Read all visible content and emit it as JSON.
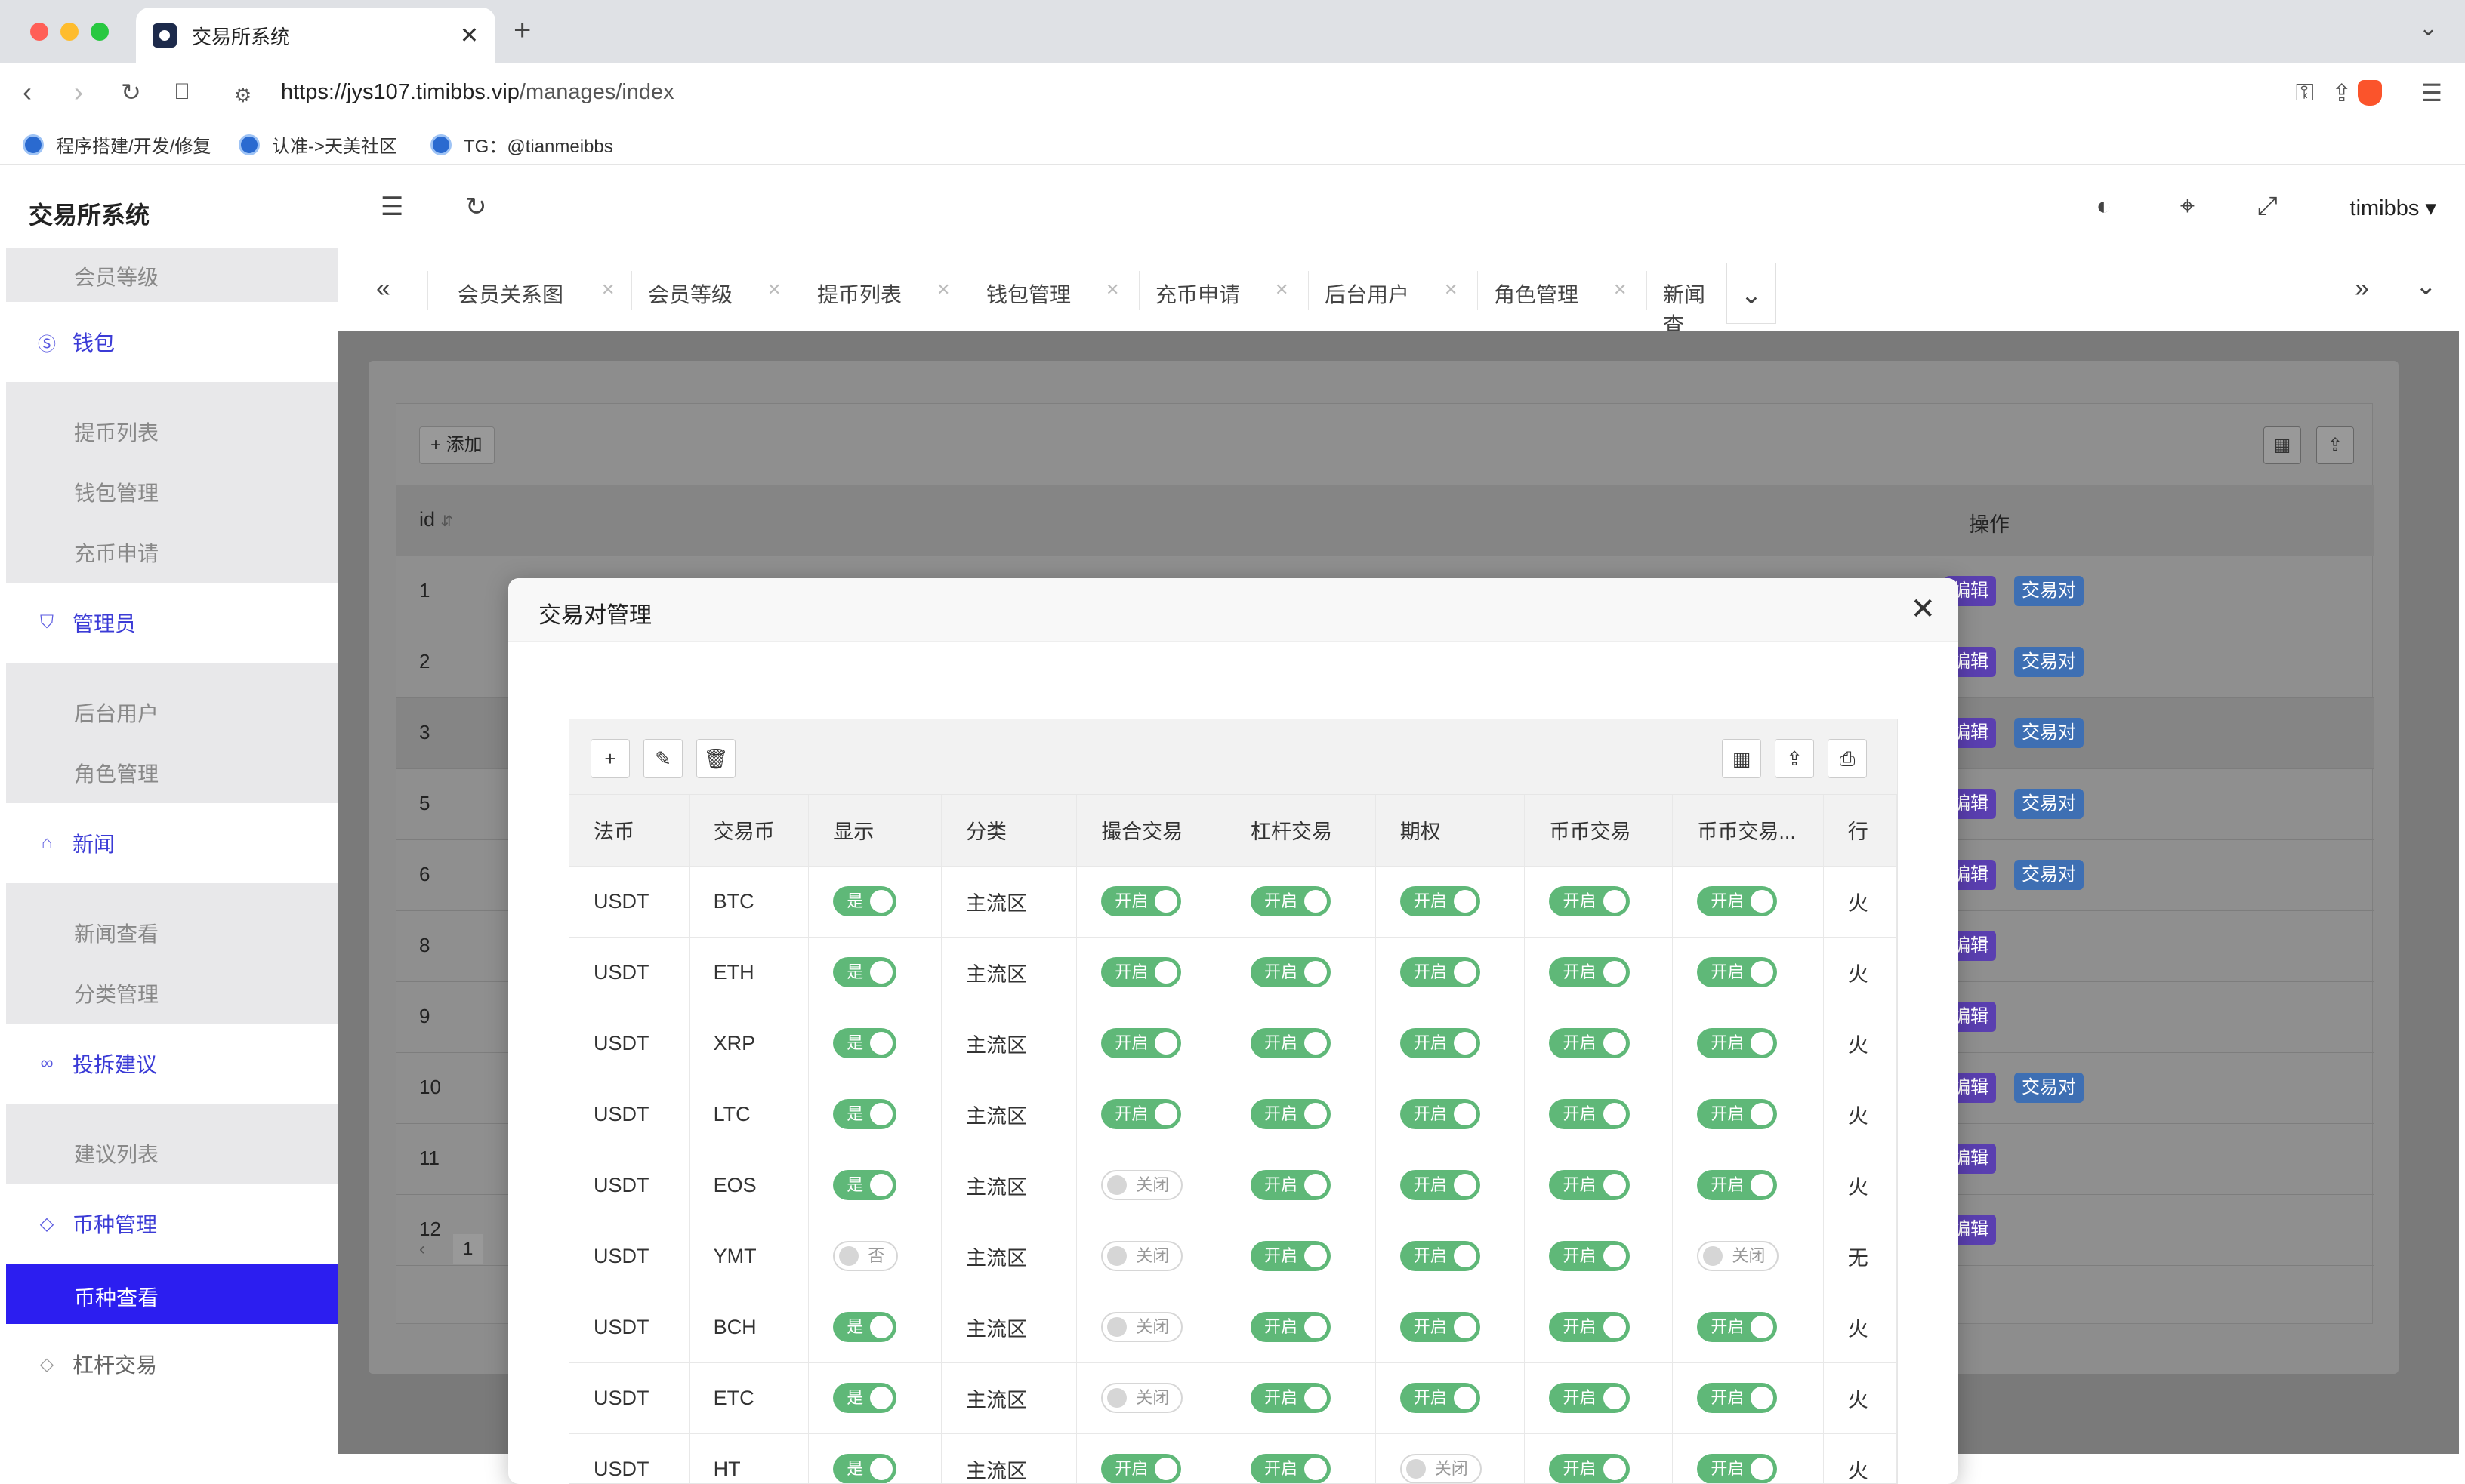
{
  "browser": {
    "tab_title": "交易所系统",
    "url_host": "https://jys107.timibbs.vip",
    "url_path": "/manages/index",
    "bookmarks": [
      "程序搭建/开发/修复",
      "认准->天美社区",
      "TG：@tianmeibbs"
    ]
  },
  "app": {
    "title": "交易所系统",
    "user": "timibbs"
  },
  "sidebar": {
    "member_level": "会员等级",
    "wallet": "钱包",
    "withdraw_list": "提币列表",
    "wallet_mgmt": "钱包管理",
    "recharge": "充币申请",
    "admin": "管理员",
    "backend_users": "后台用户",
    "roles": "角色管理",
    "news": "新闻",
    "news_view": "新闻查看",
    "category": "分类管理",
    "complaint": "投拆建议",
    "suggest_list": "建议列表",
    "coin_mgmt": "币种管理",
    "coin_view": "币种查看",
    "leverage": "杠杆交易"
  },
  "tabs": [
    "会员关系图",
    "会员等级",
    "提币列表",
    "钱包管理",
    "充币申请",
    "后台用户",
    "角色管理",
    "新闻查"
  ],
  "bg_table": {
    "add_label": "+ 添加",
    "id_header": "id",
    "ops_header": "操作",
    "edit_label": "编辑",
    "pair_label": "交易对",
    "page": "1",
    "rows": [
      {
        "id": "1",
        "pair": true
      },
      {
        "id": "2",
        "pair": true
      },
      {
        "id": "3",
        "pair": true
      },
      {
        "id": "5",
        "pair": true
      },
      {
        "id": "6",
        "pair": true
      },
      {
        "id": "8",
        "pair": false
      },
      {
        "id": "9",
        "pair": false
      },
      {
        "id": "10",
        "pair": true
      },
      {
        "id": "11",
        "pair": false
      },
      {
        "id": "12",
        "pair": false
      }
    ]
  },
  "modal": {
    "title": "交易对管理",
    "headers": [
      "法币",
      "交易币",
      "显示",
      "分类",
      "撮合交易",
      "杠杆交易",
      "期权",
      "币币交易",
      "币币交易...",
      "行"
    ],
    "on_label": "开启",
    "off_label": "关闭",
    "show_yes": "是",
    "show_no": "否",
    "rows": [
      {
        "fiat": "USDT",
        "coin": "BTC",
        "show": true,
        "cat": "主流区",
        "match": true,
        "lev": true,
        "opt": true,
        "c2c": true,
        "c2c2": true,
        "last": "火"
      },
      {
        "fiat": "USDT",
        "coin": "ETH",
        "show": true,
        "cat": "主流区",
        "match": true,
        "lev": true,
        "opt": true,
        "c2c": true,
        "c2c2": true,
        "last": "火"
      },
      {
        "fiat": "USDT",
        "coin": "XRP",
        "show": true,
        "cat": "主流区",
        "match": true,
        "lev": true,
        "opt": true,
        "c2c": true,
        "c2c2": true,
        "last": "火"
      },
      {
        "fiat": "USDT",
        "coin": "LTC",
        "show": true,
        "cat": "主流区",
        "match": true,
        "lev": true,
        "opt": true,
        "c2c": true,
        "c2c2": true,
        "last": "火"
      },
      {
        "fiat": "USDT",
        "coin": "EOS",
        "show": true,
        "cat": "主流区",
        "match": false,
        "lev": true,
        "opt": true,
        "c2c": true,
        "c2c2": true,
        "last": "火"
      },
      {
        "fiat": "USDT",
        "coin": "YMT",
        "show": false,
        "cat": "主流区",
        "match": false,
        "lev": true,
        "opt": true,
        "c2c": true,
        "c2c2": false,
        "last": "无"
      },
      {
        "fiat": "USDT",
        "coin": "BCH",
        "show": true,
        "cat": "主流区",
        "match": false,
        "lev": true,
        "opt": true,
        "c2c": true,
        "c2c2": true,
        "last": "火"
      },
      {
        "fiat": "USDT",
        "coin": "ETC",
        "show": true,
        "cat": "主流区",
        "match": false,
        "lev": true,
        "opt": true,
        "c2c": true,
        "c2c2": true,
        "last": "火"
      },
      {
        "fiat": "USDT",
        "coin": "HT",
        "show": true,
        "cat": "主流区",
        "match": true,
        "lev": true,
        "opt": false,
        "c2c": true,
        "c2c2": true,
        "last": "火"
      }
    ]
  }
}
